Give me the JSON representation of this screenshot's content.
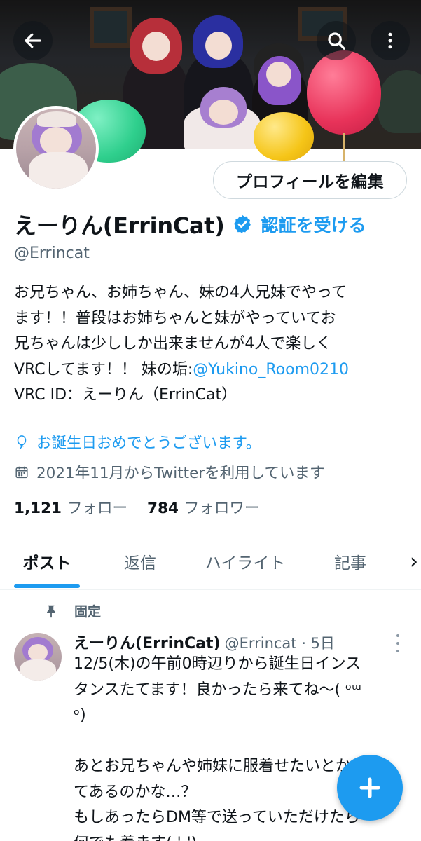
{
  "header": {
    "back_icon": "arrow-left-icon",
    "search_icon": "search-icon",
    "more_icon": "more-vertical-icon"
  },
  "profile": {
    "edit_button": "プロフィールを編集",
    "display_name": "えーりん(ErrinCat)",
    "get_verified": "認証を受ける",
    "handle": "@Errincat",
    "bio_line1": "お兄ちゃん、お姉ちゃん、妹の4人兄妹でやって",
    "bio_line2": "ます！！普段はお姉ちゃんと妹がやっていてお",
    "bio_line3": "兄ちゃんは少ししか出来ませんが4人で楽しく",
    "bio_line4_prefix": "VRCしてます！！ 妹の垢:",
    "bio_link": "@Yukino_Room0210",
    "bio_line5": "VRC ID：えーりん（ErrinCat）",
    "birthday": "お誕生日おめでとうございます。",
    "joined": "2021年11月からTwitterを利用しています",
    "following_count": "1,121",
    "following_label": "フォロー",
    "followers_count": "784",
    "followers_label": "フォロワー"
  },
  "tabs": [
    {
      "label": "ポスト",
      "active": true
    },
    {
      "label": "返信",
      "active": false
    },
    {
      "label": "ハイライト",
      "active": false
    },
    {
      "label": "記事",
      "active": false
    },
    {
      "label": "›",
      "active": false
    }
  ],
  "post": {
    "pinned_label": "固定",
    "author": "えーりん(ErrinCat)",
    "handle_time": "@Errincat · 5日",
    "body": "12/5(木)の午前0時辺りから誕生日インス\nタンスたてます！良かったら来てね〜( ᵒᵚ\nᵒ)\n\nあとお兄ちゃんや姉妹に服着せたいとかっ\nてあるのかな…？\nもしあったらDM等で送っていただけたら\n何でも着ます( '-')"
  },
  "colors": {
    "accent": "#1d9bf0",
    "text_primary": "#0f1419",
    "text_secondary": "#536471",
    "balloon_red": "#e8335a",
    "balloon_green": "#34d399",
    "balloon_yellow": "#f5c518"
  },
  "fab_icon": "plus-icon"
}
